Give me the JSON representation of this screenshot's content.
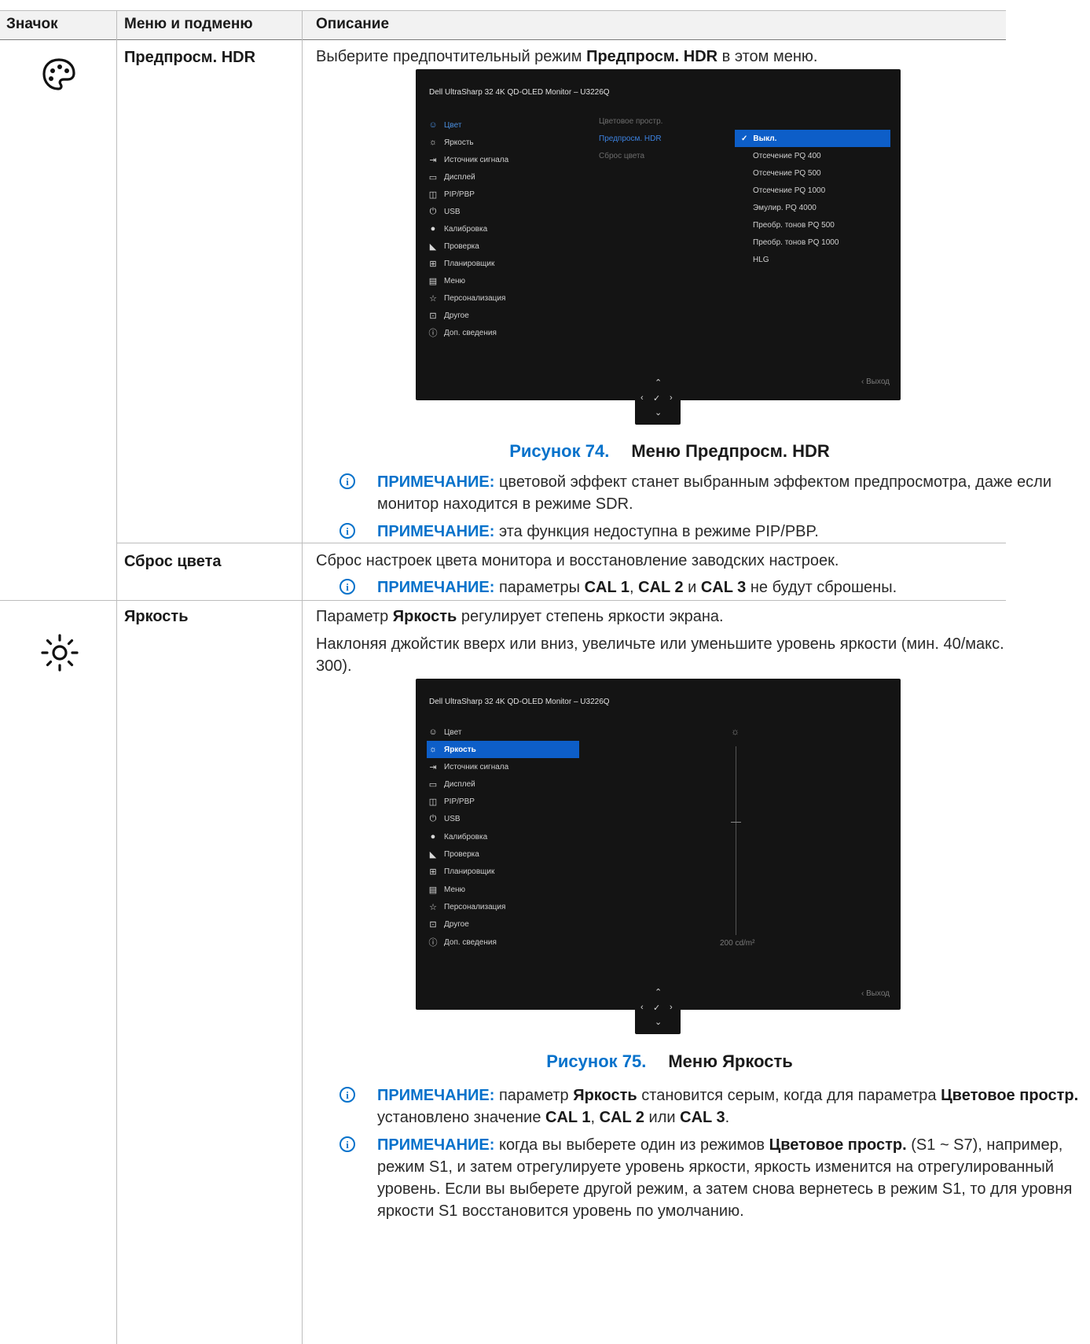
{
  "table": {
    "headers": [
      "Значок",
      "Меню и подменю",
      "Описание"
    ]
  },
  "color_section": {
    "icon": "palette-icon",
    "hdr_preview": {
      "submenu": "Предпросм. HDR",
      "desc_pre": "Выберите предпочтительный режим ",
      "desc_bold": "Предпросм. HDR",
      "desc_post": " в этом меню."
    },
    "figure": {
      "num": "Рисунок 74.",
      "title": "Меню Предпросм. HDR"
    },
    "notes": [
      {
        "label": "ПРИМЕЧАНИЕ:",
        "text": " цветовой эффект станет выбранным эффектом предпросмотра, даже если монитор находится в режиме SDR."
      },
      {
        "label": "ПРИМЕЧАНИЕ:",
        "text": " эта функция недоступна в режиме PIP/PBP."
      }
    ],
    "color_reset": {
      "submenu": "Сброс цвета",
      "desc": "Сброс настроек цвета монитора и восстановление заводских настроек.",
      "note_label": "ПРИМЕЧАНИЕ:",
      "note_1": " параметры ",
      "cal1": "CAL 1",
      "note_2": ", ",
      "cal2": "CAL 2",
      "note_3": " и ",
      "cal3": "CAL 3",
      "note_4": " не будут сброшены."
    }
  },
  "brightness_section": {
    "icon": "sun-icon",
    "submenu": "Яркость",
    "desc1_pre": "Параметр ",
    "desc1_bold": "Яркость",
    "desc1_post": " регулирует степень яркости экрана.",
    "desc2": "Наклоняя джойстик вверх или вниз, увеличьте или уменьшите уровень яркости (мин. 40/макс. 300).",
    "figure": {
      "num": "Рисунок 75.",
      "title": "Меню Яркость"
    },
    "note1": {
      "label": "ПРИМЕЧАНИЕ:",
      "t1": " параметр ",
      "b1": "Яркость",
      "t2": " становится серым, когда для параметра ",
      "b2": "Цветовое простр.",
      "t3": " установлено значение ",
      "b3": "CAL 1",
      "t4": ", ",
      "b4": "CAL 2",
      "t5": " или ",
      "b5": "CAL 3",
      "t6": "."
    },
    "note2": {
      "label": "ПРИМЕЧАНИЕ:",
      "t1": " когда вы выберете один из режимов ",
      "b1": "Цветовое простр.",
      "t2": " (S1 ~ S7), например, режим S1, и затем отрегулируете уровень яркости, яркость изменится на отрегулированный уровень. Если вы выберете другой режим, а затем снова вернетесь в режим S1, то для уровня яркости S1 восстановится уровень по умолчанию."
    }
  },
  "osd": {
    "title": "Dell UltraSharp 32 4K QD-OLED Monitor – U3226Q",
    "menu": [
      {
        "icon": "palette-icon",
        "glyph": "☺",
        "label": "Цвет"
      },
      {
        "icon": "brightness-icon",
        "glyph": "☼",
        "label": "Яркость"
      },
      {
        "icon": "input-source-icon",
        "glyph": "⇥",
        "label": "Источник сигнала"
      },
      {
        "icon": "display-icon",
        "glyph": "▭",
        "label": "Дисплей"
      },
      {
        "icon": "pip-pbp-icon",
        "glyph": "◫",
        "label": "PIP/PBP"
      },
      {
        "icon": "usb-icon",
        "glyph": "⏻",
        "label": "USB"
      },
      {
        "icon": "calibration-icon",
        "glyph": "●",
        "label": "Калибровка"
      },
      {
        "icon": "validation-icon",
        "glyph": "◣",
        "label": "Проверка"
      },
      {
        "icon": "scheduler-icon",
        "glyph": "⊞",
        "label": "Планировщик"
      },
      {
        "icon": "menu-icon",
        "glyph": "▤",
        "label": "Меню"
      },
      {
        "icon": "star-icon",
        "glyph": "☆",
        "label": "Персонализация"
      },
      {
        "icon": "other-icon",
        "glyph": "⊡",
        "label": "Другое"
      },
      {
        "icon": "info-icon",
        "glyph": "ⓘ",
        "label": "Доп. сведения"
      }
    ],
    "color_sub": [
      "Цветовое простр.",
      "Предпросм. HDR",
      "Сброс цвета"
    ],
    "hdr_options": [
      "Выкл.",
      "Отсечение PQ 400",
      "Отсечение PQ 500",
      "Отсечение PQ 1000",
      "Эмулир. PQ 4000",
      "Преобр. тонов PQ 500",
      "Преобр. тонов PQ 1000",
      "HLG"
    ],
    "selected_check": "✓",
    "exit": "Выход",
    "brightness_value": "200 cd/m²",
    "brightness_level_fraction": 0.6
  }
}
